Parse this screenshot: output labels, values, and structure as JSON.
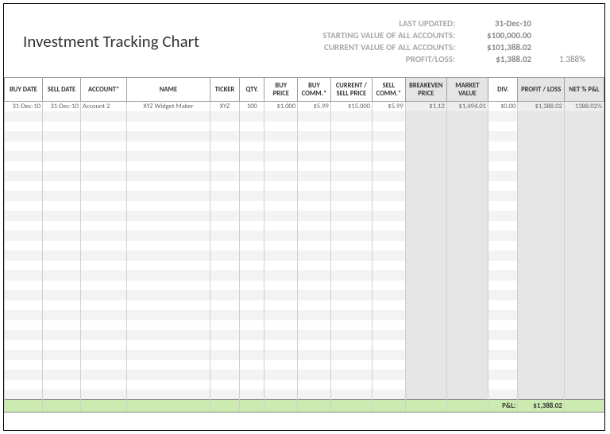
{
  "title": "Investment Tracking Chart",
  "summary": {
    "labels": {
      "last_updated": "LAST UPDATED:",
      "starting": "STARTING VALUE OF ALL ACCOUNTS:",
      "current": "CURRENT VALUE OF ALL ACCOUNTS:",
      "profit_loss": "PROFIT/LOSS:"
    },
    "values": {
      "last_updated": "31-Dec-10",
      "starting": "$100,000.00",
      "current": "$101,388.02",
      "profit_loss": "$1,388.02",
      "pct": "1.388%"
    }
  },
  "columns": [
    "BUY DATE",
    "SELL DATE",
    "ACCOUNT*",
    "NAME",
    "TICKER",
    "QTY.",
    "BUY PRICE",
    "BUY COMM.*",
    "CURRENT / SELL PRICE",
    "SELL COMM.*",
    "BREAKEVEN PRICE",
    "MARKET VALUE",
    "DIV.",
    "PROFIT / LOSS",
    "NET % P&L"
  ],
  "row": {
    "buy_date": "31-Dec-10",
    "sell_date": "31-Dec-10",
    "account": "Account 2",
    "name": "XYZ Widget Maker",
    "ticker": "XYZ",
    "qty": "100",
    "buy_price": "$1.000",
    "buy_comm": "$5.99",
    "current": "$15.000",
    "sell_comm": "$5.99",
    "breakeven": "$1.12",
    "market_value": "$1,494.01",
    "div": "$0.00",
    "profit_loss": "$1,388.02",
    "net_pct": "1388.02%"
  },
  "totals": {
    "label": "P&L:",
    "value": "$1,388.02"
  }
}
